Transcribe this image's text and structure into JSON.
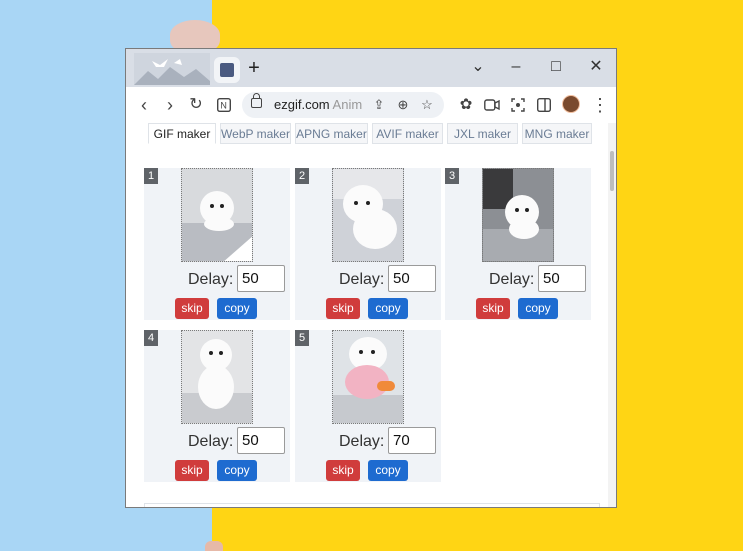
{
  "browser": {
    "url_host": "ezgif.com",
    "url_rest": "Anim"
  },
  "nav_tabs": [
    {
      "label": "GIF maker",
      "active": true
    },
    {
      "label": "WebP maker",
      "active": false
    },
    {
      "label": "APNG maker",
      "active": false
    },
    {
      "label": "AVIF maker",
      "active": false
    },
    {
      "label": "JXL maker",
      "active": false
    },
    {
      "label": "MNG maker",
      "active": false
    }
  ],
  "frames": [
    {
      "number": "1",
      "delay_label": "Delay:",
      "delay": "50",
      "skip_label": "skip",
      "copy_label": "copy"
    },
    {
      "number": "2",
      "delay_label": "Delay:",
      "delay": "50",
      "skip_label": "skip",
      "copy_label": "copy"
    },
    {
      "number": "3",
      "delay_label": "Delay:",
      "delay": "50",
      "skip_label": "skip",
      "copy_label": "copy"
    },
    {
      "number": "4",
      "delay_label": "Delay:",
      "delay": "50",
      "skip_label": "skip",
      "copy_label": "copy"
    },
    {
      "number": "5",
      "delay_label": "Delay:",
      "delay": "70",
      "skip_label": "skip",
      "copy_label": "copy"
    }
  ],
  "colors": {
    "skip_button": "#d03c3c",
    "copy_button": "#1e6bd0",
    "desktop_left": "#a9d6f5",
    "desktop_right": "#ffd514"
  },
  "icons": [
    "back-icon",
    "forward-icon",
    "reload-icon",
    "notion-icon",
    "lock-icon",
    "share-icon",
    "zoom-icon",
    "bookmark-star-icon",
    "extensions-icon",
    "camera-icon",
    "scan-icon",
    "sidepanel-icon",
    "profile-avatar",
    "menu-icon"
  ]
}
